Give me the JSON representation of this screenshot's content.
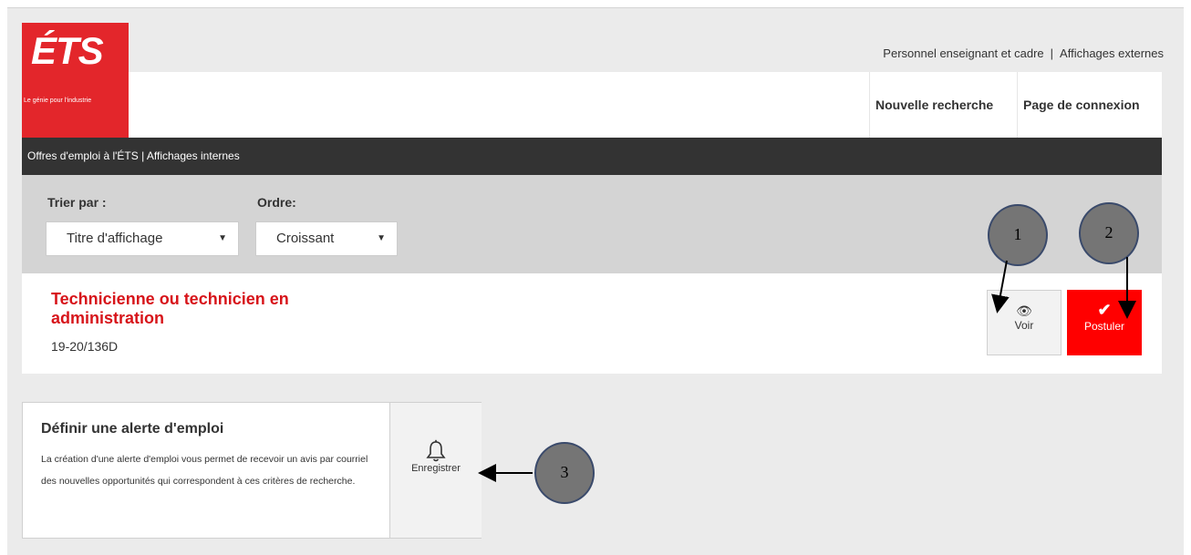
{
  "logo": {
    "mark": "ÉTS",
    "tagline": "Le génie pour l'industrie"
  },
  "top_links": {
    "staff": "Personnel enseignant et cadre",
    "separator": "|",
    "external": "Affichages externes"
  },
  "nav": {
    "new_search": "Nouvelle recherche",
    "login_page": "Page de connexion"
  },
  "breadcrumb": "Offres d'emploi à l'ÉTS | Affichages internes",
  "sort": {
    "sort_by_label": "Trier par :",
    "sort_by_value": "Titre d'affichage",
    "order_label": "Ordre:",
    "order_value": "Croissant"
  },
  "job": {
    "title": "Technicienne ou technicien en administration",
    "reference": "19-20/136D",
    "view_label": "Voir",
    "apply_label": "Postuler"
  },
  "alert": {
    "title": "Définir une alerte d'emploi",
    "description": "La création d'une alerte d'emploi vous permet de recevoir un avis par courriel des nouvelles opportunités qui correspondent à ces critères de recherche.",
    "save_label": "Enregistrer"
  },
  "annotations": {
    "one": "1",
    "two": "2",
    "three": "3"
  },
  "colors": {
    "brand_red": "#e3262b",
    "apply_red": "#ff0000",
    "job_title_red": "#d7141a",
    "dark_bar": "#333333"
  },
  "icons": {
    "view": "eye-icon",
    "apply": "checkmark-icon",
    "save": "bell-icon"
  }
}
